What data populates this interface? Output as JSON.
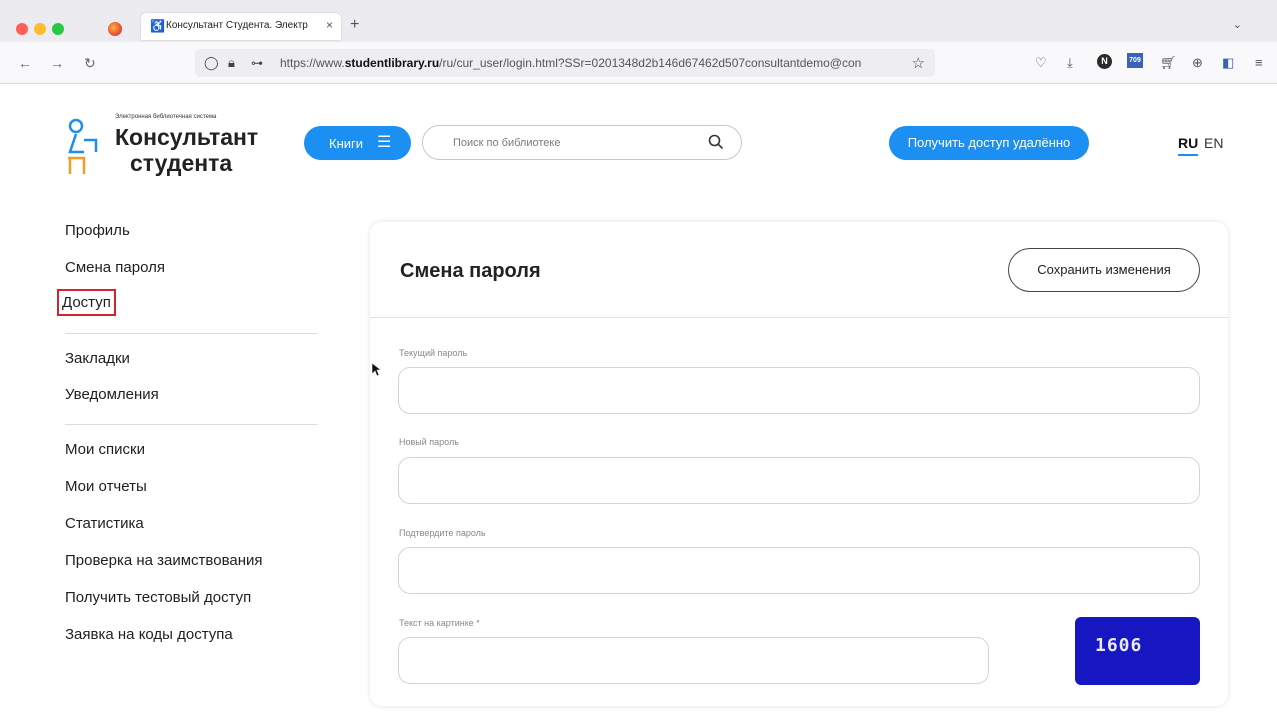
{
  "browser": {
    "tab_title": "Консультант Студента. Электр",
    "tab_close": "×",
    "new_tab": "+",
    "tabs_menu": "⌄",
    "url_prefix": "https://www.",
    "url_domain": "studentlibrary.ru",
    "url_rest": "/ru/cur_user/login.html?SSr=0201348d2b146d67462d507consultantdemo@con",
    "toolbar_badge": "709",
    "toolbar_n": "N"
  },
  "header": {
    "logo_tagline": "Электронная библиотечная система",
    "logo_line1": "Консультант",
    "logo_line2": "студента",
    "books_label": "Книги",
    "search_placeholder": "Поиск по библиотеке",
    "remote_access_label": "Получить доступ удалённо",
    "lang_ru": "RU",
    "lang_en": "EN"
  },
  "sidebar": {
    "group1": [
      "Профиль",
      "Смена пароля",
      "Доступ"
    ],
    "group2": [
      "Закладки",
      "Уведомления"
    ],
    "group3": [
      "Мои списки",
      "Мои отчеты",
      "Статистика",
      "Проверка на заимствования",
      "Получить тестовый доступ",
      "Заявка на коды доступа"
    ]
  },
  "main": {
    "title": "Смена пароля",
    "save_label": "Сохранить изменения",
    "fields": {
      "current_password_label": "Текущий пароль",
      "new_password_label": "Новый пароль",
      "confirm_password_label": "Подтвердите пароль",
      "captcha_label": "Текст на картинке *"
    },
    "captcha_text": "1606"
  },
  "colors": {
    "accent": "#1b8ff2",
    "highlight_border": "#d4242d",
    "captcha_bg": "#1717c2"
  }
}
